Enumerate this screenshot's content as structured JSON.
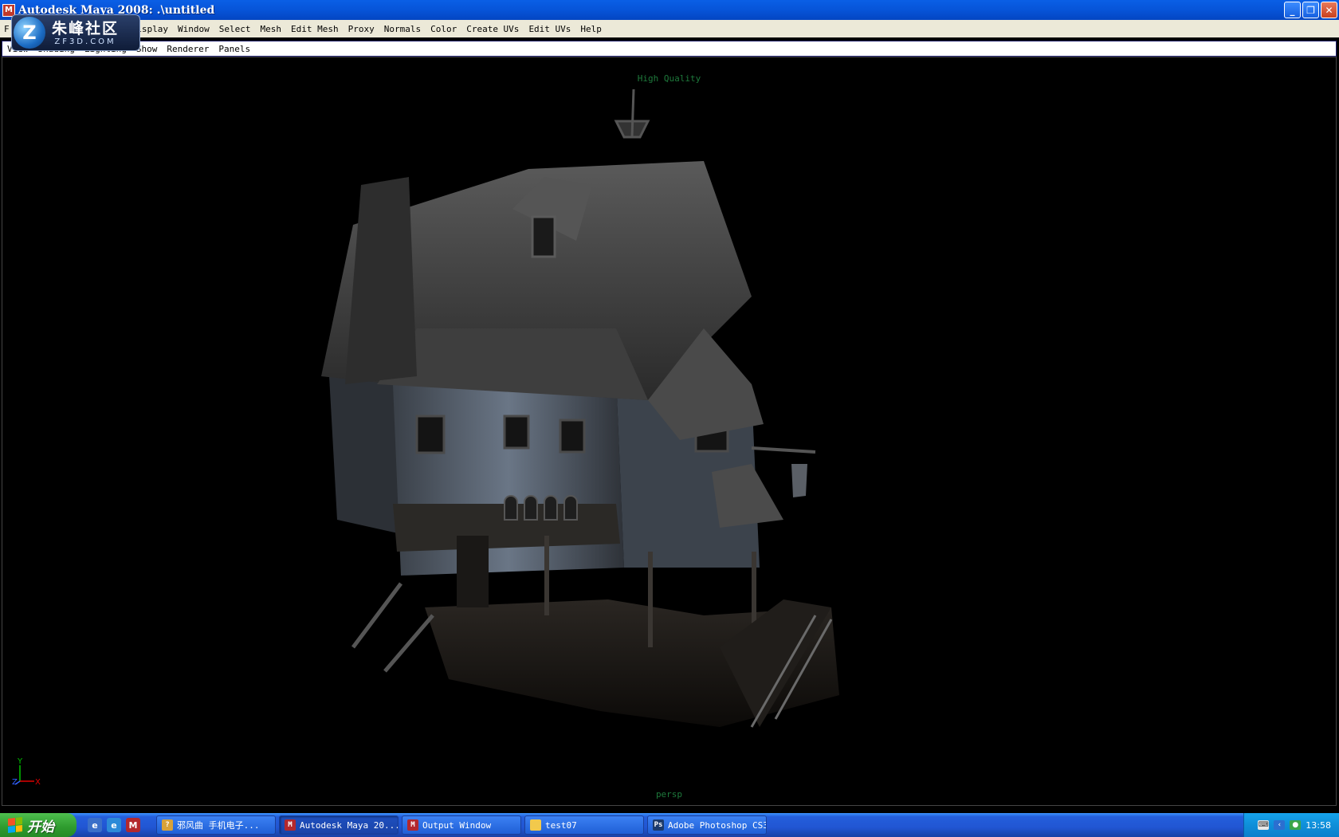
{
  "window": {
    "title": "Autodesk Maya 2008: .\\untitled",
    "app_icon_glyph": "M"
  },
  "watermark": {
    "chinese": "朱峰社区",
    "url": "ZF3D.COM",
    "glyph": "Z"
  },
  "menubar": {
    "items": [
      "F",
      "Display",
      "Window",
      "Select",
      "Mesh",
      "Edit Mesh",
      "Proxy",
      "Normals",
      "Color",
      "Create UVs",
      "Edit UVs",
      "Help"
    ]
  },
  "panel_menu": {
    "items": [
      "View",
      "Shading",
      "Lighting",
      "Show",
      "Renderer",
      "Panels"
    ]
  },
  "viewport": {
    "hud_top": "High Quality",
    "camera_label": "persp",
    "axis": {
      "y": "Y",
      "x": "X",
      "z": "Z"
    }
  },
  "taskbar": {
    "start_label": "开始",
    "tasks": [
      {
        "label": "邪风曲  手机电子...",
        "icon": "question-icon",
        "active": false
      },
      {
        "label": "Autodesk Maya 20...",
        "icon": "maya-icon",
        "active": true
      },
      {
        "label": "Output Window",
        "icon": "maya-icon",
        "active": false
      },
      {
        "label": "test07",
        "icon": "folder-icon",
        "active": false
      },
      {
        "label": "Adobe Photoshop CS3",
        "icon": "photoshop-icon",
        "active": false
      }
    ],
    "clock": "13:58"
  },
  "colors": {
    "title_bar": "#0754d8",
    "menu_bg": "#ece9d8",
    "hud_text": "#1e7a3c",
    "taskbar": "#245edb",
    "start_button": "#2e9b2e"
  }
}
